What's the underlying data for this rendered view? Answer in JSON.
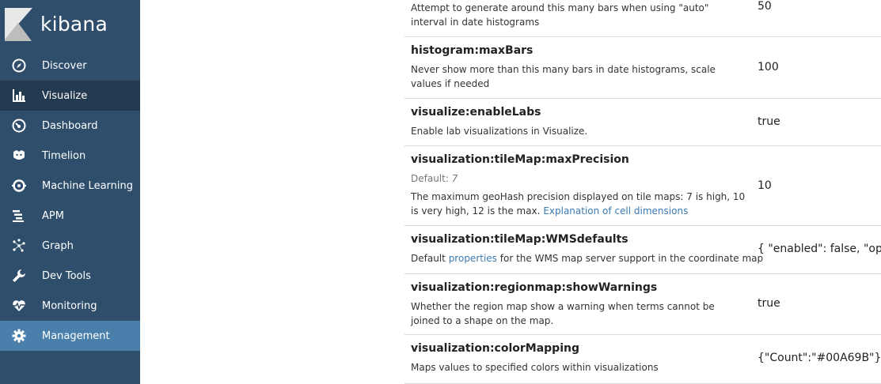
{
  "brand": {
    "name": "kibana"
  },
  "nav": [
    {
      "label": "Discover",
      "icon": "compass-icon"
    },
    {
      "label": "Visualize",
      "icon": "bar-chart-icon"
    },
    {
      "label": "Dashboard",
      "icon": "gauge-icon"
    },
    {
      "label": "Timelion",
      "icon": "timelion-icon"
    },
    {
      "label": "Machine Learning",
      "icon": "machine-learning-icon"
    },
    {
      "label": "APM",
      "icon": "apm-icon"
    },
    {
      "label": "Graph",
      "icon": "graph-icon"
    },
    {
      "label": "Dev Tools",
      "icon": "wrench-icon"
    },
    {
      "label": "Monitoring",
      "icon": "heartbeat-icon"
    },
    {
      "label": "Management",
      "icon": "gear-icon"
    }
  ],
  "settings": {
    "row0": {
      "description": "Attempt to generate around this many bars when using \"auto\" interval in date histograms",
      "value": "50"
    },
    "row1": {
      "name": "histogram:maxBars",
      "description": "Never show more than this many bars in date histograms, scale values if needed",
      "value": "100"
    },
    "row2": {
      "name": "visualize:enableLabs",
      "description": "Enable lab visualizations in Visualize.",
      "value": "true"
    },
    "row3": {
      "name": "visualization:tileMap:maxPrecision",
      "default_label": "Default:",
      "default_value": "7",
      "description": "The maximum geoHash precision displayed on tile maps: 7 is high, 10 is very high, 12 is the max.",
      "link": "Explanation of cell dimensions",
      "value": "10"
    },
    "row4": {
      "name": "visualization:tileMap:WMSdefaults",
      "desc_before": "Default",
      "link": "properties",
      "desc_after": "for the WMS map server support in the coordinate map",
      "value": "{ \"enabled\": false, \"optio"
    },
    "row5": {
      "name": "visualization:regionmap:showWarnings",
      "description": "Whether the region map show a warning when terms cannot be joined to a shape on the map.",
      "value": "true"
    },
    "row6": {
      "name": "visualization:colorMapping",
      "description": "Maps values to specified colors within visualizations",
      "value": "{\"Count\":\"#00A69B\"}"
    }
  },
  "colors": {
    "sidebar_bg": "#2e4e6b",
    "sidebar_active": "#233a51",
    "sidebar_selected": "#4a7fac",
    "link": "#3a7bb3"
  }
}
